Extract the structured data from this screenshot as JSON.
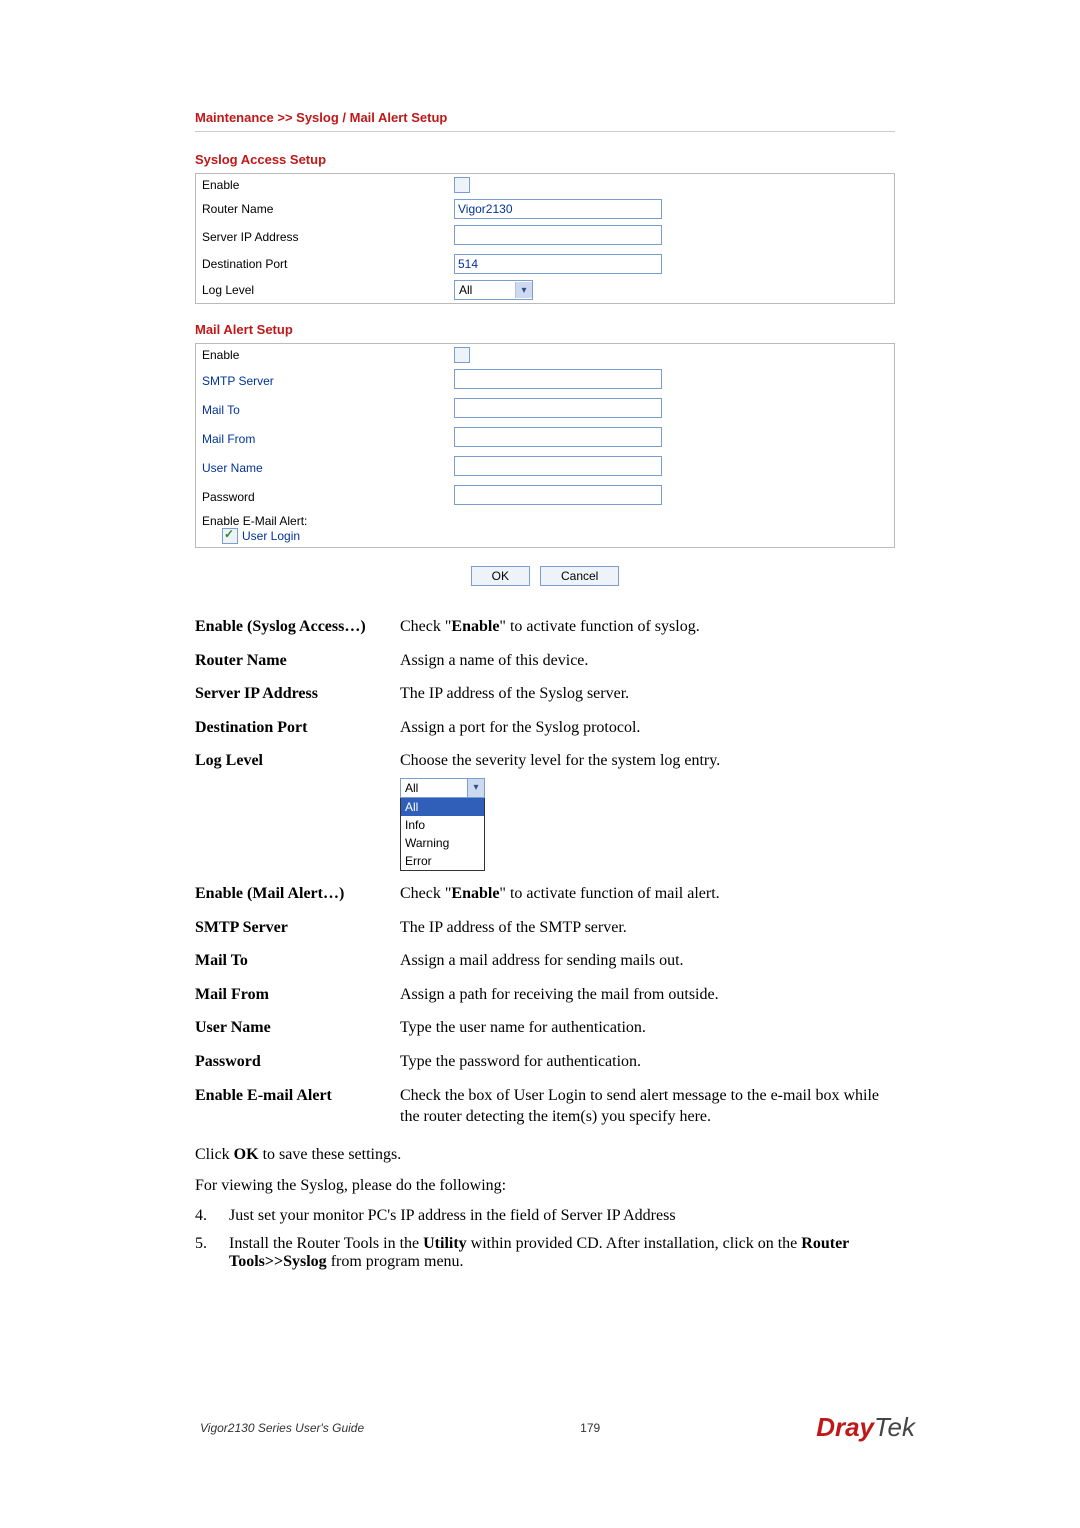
{
  "breadcrumb": "Maintenance >> Syslog / Mail Alert Setup",
  "syslog": {
    "section_title": "Syslog Access Setup",
    "enable_label": "Enable",
    "router_name_label": "Router Name",
    "router_name_value": "Vigor2130",
    "server_ip_label": "Server IP Address",
    "server_ip_value": "",
    "dest_port_label": "Destination Port",
    "dest_port_value": "514",
    "log_level_label": "Log Level",
    "log_level_value": "All"
  },
  "mail": {
    "section_title": "Mail Alert Setup",
    "enable_label": "Enable",
    "smtp_label": "SMTP Server",
    "smtp_value": "",
    "mailto_label": "Mail To",
    "mailto_value": "",
    "mailfrom_label": "Mail From",
    "mailfrom_value": "",
    "username_label": "User Name",
    "username_value": "",
    "password_label": "Password",
    "password_value": "",
    "email_alert_label": "Enable E-Mail Alert:",
    "user_login_label": "User Login"
  },
  "buttons": {
    "ok": "OK",
    "cancel": "Cancel"
  },
  "defs": {
    "enable_syslog": {
      "term": "Enable (Syslog Access…)",
      "pre": "Check \"",
      "bold": "Enable",
      "post": "\" to activate function of syslog."
    },
    "router_name": {
      "term": "Router Name",
      "def": "Assign a name of this device."
    },
    "server_ip": {
      "term": "Server IP Address",
      "def": "The IP address of the Syslog server."
    },
    "dest_port": {
      "term": "Destination Port",
      "def": "Assign a port for the Syslog protocol."
    },
    "log_level": {
      "term": "Log Level",
      "def": "Choose the severity level for the system log entry.",
      "options": {
        "selected": "All",
        "list": [
          "All",
          "Info",
          "Warning",
          "Error"
        ]
      }
    },
    "enable_mail": {
      "term": "Enable (Mail Alert…)",
      "pre": "Check \"",
      "bold": "Enable",
      "post": "\" to activate function of mail alert."
    },
    "smtp": {
      "term": "SMTP Server",
      "def": "The IP address of the SMTP server."
    },
    "mailto": {
      "term": "Mail To",
      "def": "Assign a mail address for sending mails out."
    },
    "mailfrom": {
      "term": "Mail From",
      "def": "Assign a path for receiving the mail from outside."
    },
    "username": {
      "term": "User Name",
      "def": "Type the user name for authentication."
    },
    "password": {
      "term": "Password",
      "def": "Type the password for authentication."
    },
    "email_alert": {
      "term": "Enable E-mail Alert",
      "def": "Check the box of User Login to send alert message to the e-mail box while the router detecting the item(s) you specify here."
    }
  },
  "closing": {
    "click_ok_pre": "Click ",
    "click_ok_bold": "OK",
    "click_ok_post": " to save these settings.",
    "view_syslog": "For viewing the Syslog, please do the following:",
    "step4_num": "4.",
    "step4": "Just set your monitor PC's IP address in the field of Server IP Address",
    "step5_num": "5.",
    "step5_pre": "Install the Router Tools in the ",
    "step5_bold1": "Utility",
    "step5_mid": " within provided CD. After installation, click on the ",
    "step5_bold2": "Router Tools>>Syslog",
    "step5_post": " from program menu."
  },
  "footer": {
    "guide": "Vigor2130 Series User's Guide",
    "page": "179",
    "logo_dray": "Dray",
    "logo_tek": "Tek"
  }
}
